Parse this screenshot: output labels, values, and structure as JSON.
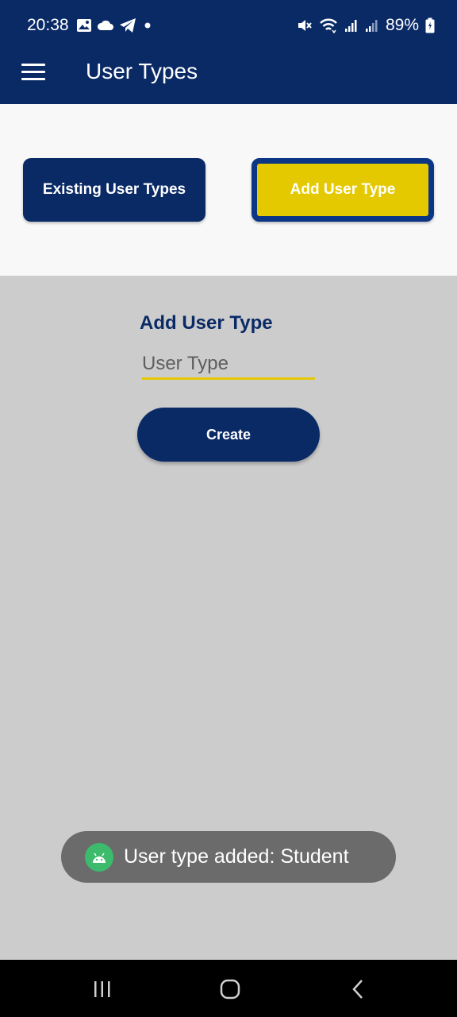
{
  "status_bar": {
    "time": "20:38",
    "battery": "89%",
    "icons": [
      "image-icon",
      "cloud-icon",
      "telegram-icon",
      "dot-icon",
      "mute-icon",
      "wifi-icon",
      "signal-icon",
      "signal-icon-2",
      "battery-icon"
    ]
  },
  "app_bar": {
    "title": "User Types",
    "menu_icon": "hamburger-menu-icon"
  },
  "tabs": {
    "existing_label": "Existing User Types",
    "add_label": "Add User Type"
  },
  "form": {
    "title": "Add User Type",
    "input_placeholder": "User Type",
    "input_value": "",
    "create_label": "Create"
  },
  "toast": {
    "message": "User type added: Student",
    "icon": "android-icon"
  },
  "nav_bar": {
    "buttons": [
      "recents-icon",
      "home-icon",
      "back-icon"
    ]
  },
  "colors": {
    "primary": "#0a2a66",
    "accent": "#e5c900",
    "selected_border": "#0b3585",
    "background": "#cccccc",
    "panel": "#f8f8f8",
    "toast": "#6b6b6b"
  }
}
